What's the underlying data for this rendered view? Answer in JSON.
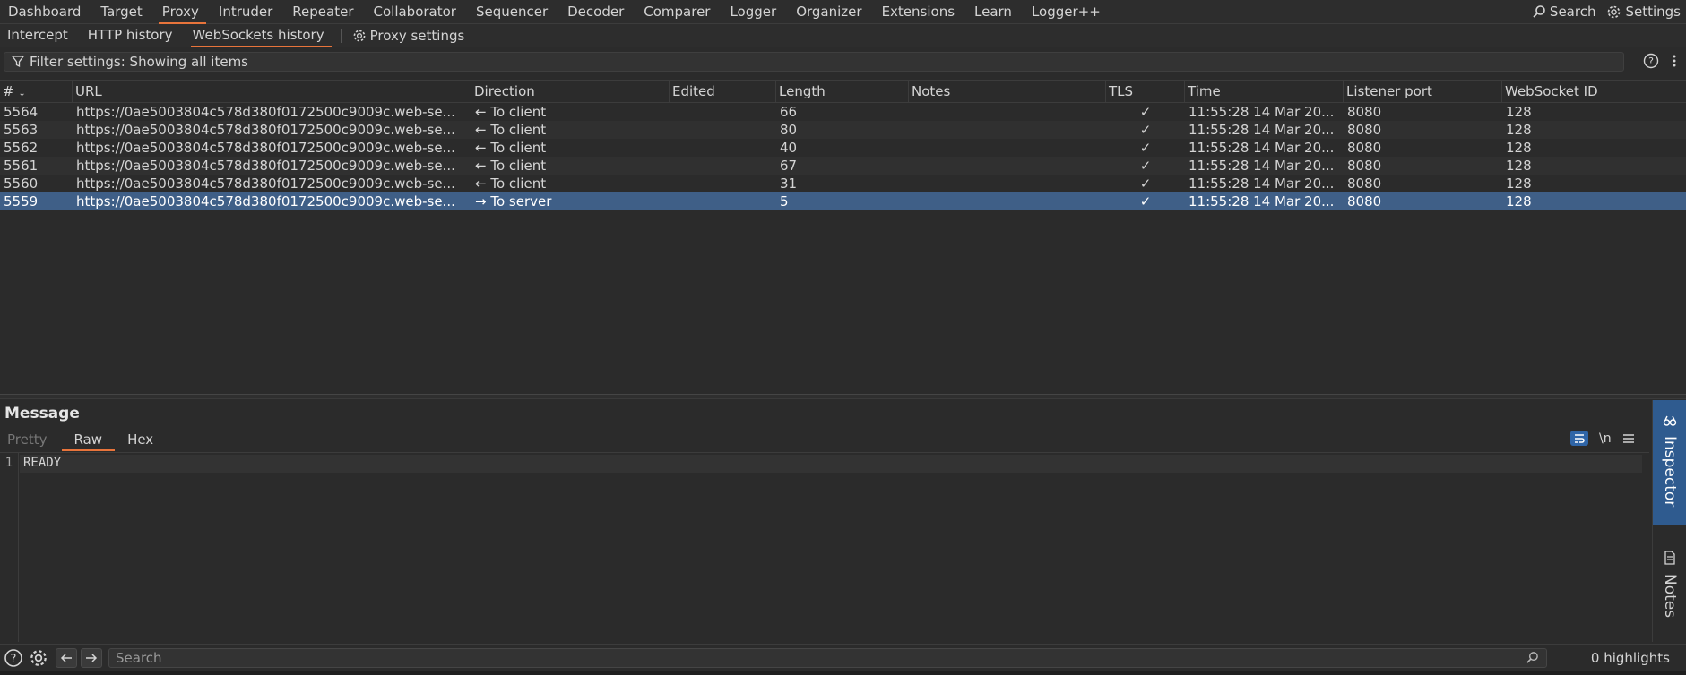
{
  "top_tabs": [
    "Dashboard",
    "Target",
    "Proxy",
    "Intruder",
    "Repeater",
    "Collaborator",
    "Sequencer",
    "Decoder",
    "Comparer",
    "Logger",
    "Organizer",
    "Extensions",
    "Learn",
    "Logger++"
  ],
  "top_right": {
    "search_label": "Search",
    "settings_label": "Settings"
  },
  "sub_tabs": [
    "Intercept",
    "HTTP history",
    "WebSockets history"
  ],
  "proxy_settings_label": "Proxy settings",
  "filter_text": "Filter settings: Showing all items",
  "columns": [
    "#",
    "URL",
    "Direction",
    "Edited",
    "Length",
    "Notes",
    "TLS",
    "Time",
    "Listener port",
    "WebSocket ID"
  ],
  "rows": [
    {
      "num": "5564",
      "url": "https://0ae5003804c578d380f0172500c9009c.web-se...",
      "direction": "← To client",
      "edited": "",
      "length": "66",
      "notes": "",
      "tls": "✓",
      "time": "11:55:28 14 Mar 20...",
      "port": "8080",
      "ws_id": "128"
    },
    {
      "num": "5563",
      "url": "https://0ae5003804c578d380f0172500c9009c.web-se...",
      "direction": "← To client",
      "edited": "",
      "length": "80",
      "notes": "",
      "tls": "✓",
      "time": "11:55:28 14 Mar 20...",
      "port": "8080",
      "ws_id": "128"
    },
    {
      "num": "5562",
      "url": "https://0ae5003804c578d380f0172500c9009c.web-se...",
      "direction": "← To client",
      "edited": "",
      "length": "40",
      "notes": "",
      "tls": "✓",
      "time": "11:55:28 14 Mar 20...",
      "port": "8080",
      "ws_id": "128"
    },
    {
      "num": "5561",
      "url": "https://0ae5003804c578d380f0172500c9009c.web-se...",
      "direction": "← To client",
      "edited": "",
      "length": "67",
      "notes": "",
      "tls": "✓",
      "time": "11:55:28 14 Mar 20...",
      "port": "8080",
      "ws_id": "128"
    },
    {
      "num": "5560",
      "url": "https://0ae5003804c578d380f0172500c9009c.web-se...",
      "direction": "← To client",
      "edited": "",
      "length": "31",
      "notes": "",
      "tls": "✓",
      "time": "11:55:28 14 Mar 20...",
      "port": "8080",
      "ws_id": "128"
    },
    {
      "num": "5559",
      "url": "https://0ae5003804c578d380f0172500c9009c.web-se...",
      "direction": "→ To server",
      "edited": "",
      "length": "5",
      "notes": "",
      "tls": "✓",
      "time": "11:55:28 14 Mar 20...",
      "port": "8080",
      "ws_id": "128"
    }
  ],
  "selected_row": "5559",
  "message": {
    "title": "Message",
    "tabs": [
      "Pretty",
      "Raw",
      "Hex"
    ],
    "line_number": "1",
    "content": "READY",
    "newline_toggle": "\\n"
  },
  "sidebar": {
    "inspector": "Inspector",
    "notes": "Notes"
  },
  "bottom": {
    "search_placeholder": "Search",
    "highlights": "0 highlights"
  },
  "colors": {
    "accent": "#e8743b",
    "selection": "#3f5f87",
    "inspector": "#2f5b8f"
  }
}
